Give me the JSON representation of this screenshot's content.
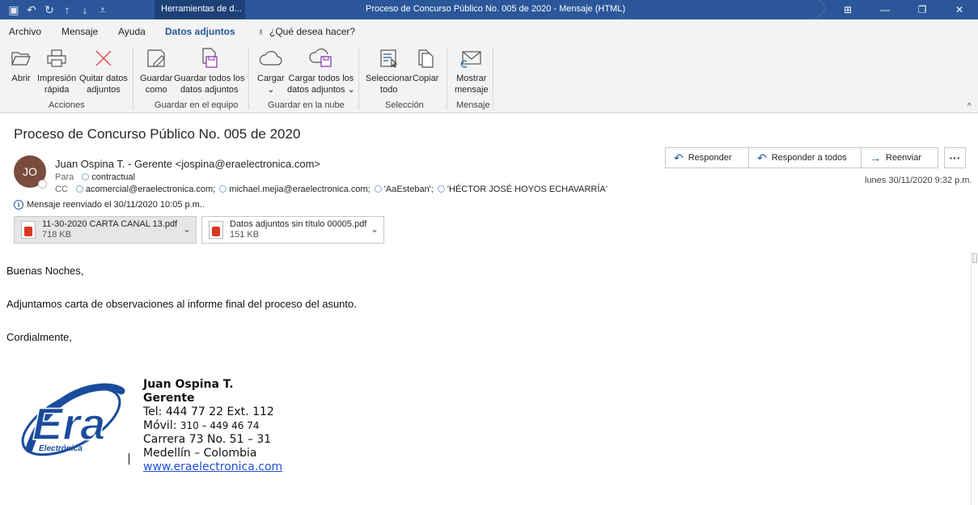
{
  "titlebar": {
    "context_tab": "Herramientas de d...",
    "window_title": "Proceso de Concurso Público No. 005 de 2020  -  Mensaje (HTML)",
    "colors": {
      "bar": "#2b579a",
      "context": "#1d4177"
    }
  },
  "tabs": [
    {
      "label": "Archivo"
    },
    {
      "label": "Mensaje"
    },
    {
      "label": "Ayuda"
    },
    {
      "label": "Datos adjuntos",
      "active": true
    },
    {
      "label": "¿Qué desea hacer?"
    }
  ],
  "ribbon": {
    "buttons": [
      {
        "line1": "Abrir",
        "line2": "",
        "icon": "folder-open-icon"
      },
      {
        "line1": "Impresión",
        "line2": "rápida",
        "icon": "printer-icon"
      },
      {
        "line1": "Quitar datos",
        "line2": "adjuntos",
        "icon": "remove-x-icon"
      },
      {
        "line1": "Guardar",
        "line2": "como",
        "icon": "save-as-icon"
      },
      {
        "line1": "Guardar todos los",
        "line2": "datos adjuntos",
        "icon": "save-all-icon"
      },
      {
        "line1": "Cargar",
        "line2": "⌄",
        "icon": "cloud-icon"
      },
      {
        "line1": "Cargar todos los",
        "line2": "datos adjuntos ⌄",
        "icon": "cloud-save-icon"
      },
      {
        "line1": "Seleccionar",
        "line2": "todo",
        "icon": "select-all-icon"
      },
      {
        "line1": "Copiar",
        "line2": "",
        "icon": "copy-icon"
      },
      {
        "line1": "Mostrar",
        "line2": "mensaje",
        "icon": "envelope-icon"
      }
    ],
    "groups": [
      "Acciones",
      "Guardar en el equipo",
      "Guardar en la nube",
      "Selección",
      "Mensaje"
    ]
  },
  "message": {
    "subject": "Proceso de Concurso Público No. 005 de 2020",
    "avatar_initials": "JO",
    "avatar_color": "#7a4c3d",
    "sender": "Juan Ospina T. - Gerente <jospina@eraelectronica.com>",
    "to_label": "Para",
    "to": "contractual",
    "cc_label": "CC",
    "cc": [
      "acomercial@eraelectronica.com;",
      "michael.mejia@eraelectronica.com;",
      "'AaEsteban';",
      "'HÉCTOR JOSÉ HOYOS ECHAVARRÍA'"
    ],
    "forwarded_info": "Mensaje reenviado el 30/11/2020 10:05 p.m..",
    "date": "lunes 30/11/2020 9:32 p.m.",
    "actions": {
      "reply": "Responder",
      "reply_all": "Responder a todos",
      "forward": "Reenviar",
      "more": "···"
    },
    "attachments": [
      {
        "name": "11-30-2020 CARTA CANAL 13.pdf",
        "size": "718 KB"
      },
      {
        "name": "Datos adjuntos sin título 00005.pdf",
        "size": "151 KB"
      }
    ]
  },
  "body": {
    "greeting": "Buenas Noches,",
    "paragraph": "Adjuntamos carta de observaciones al informe final del proceso del asunto.",
    "closing": "Cordialmente,"
  },
  "signature": {
    "name": "Juan Ospina T.",
    "title": "Gerente",
    "phone": "Tel: 444 77 22 Ext. 112",
    "mobile_label": "Móvil: ",
    "mobile": "310 – 449 46 74",
    "address": "Carrera 73 No. 51 – 31",
    "city": "Medellín – Colombia",
    "website": "www.eraelectronica.com",
    "logo_text": "Era",
    "logo_subtext": "Electrónica"
  }
}
